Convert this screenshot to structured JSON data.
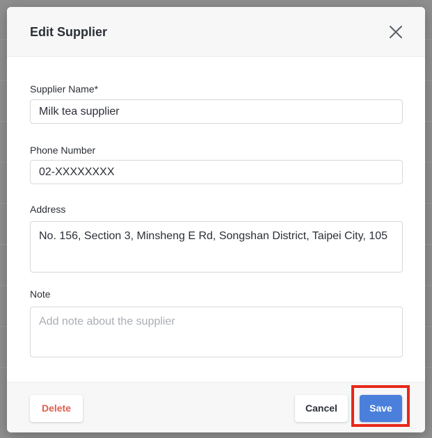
{
  "dialog": {
    "title": "Edit Supplier"
  },
  "form": {
    "supplier_name": {
      "label": "Supplier Name*",
      "value": "Milk tea supplier"
    },
    "phone_number": {
      "label": "Phone Number",
      "value": "02-XXXXXXXX"
    },
    "address": {
      "label": "Address",
      "value": "No. 156, Section 3, Minsheng E Rd, Songshan District, Taipei City, 105"
    },
    "note": {
      "label": "Note",
      "value": "",
      "placeholder": "Add note about the supplier"
    }
  },
  "footer": {
    "delete_label": "Delete",
    "cancel_label": "Cancel",
    "save_label": "Save"
  },
  "icons": {
    "close": "close-icon"
  },
  "colors": {
    "primary": "#4a7fdc",
    "danger": "#e05d4c",
    "highlight": "#e8271a"
  }
}
